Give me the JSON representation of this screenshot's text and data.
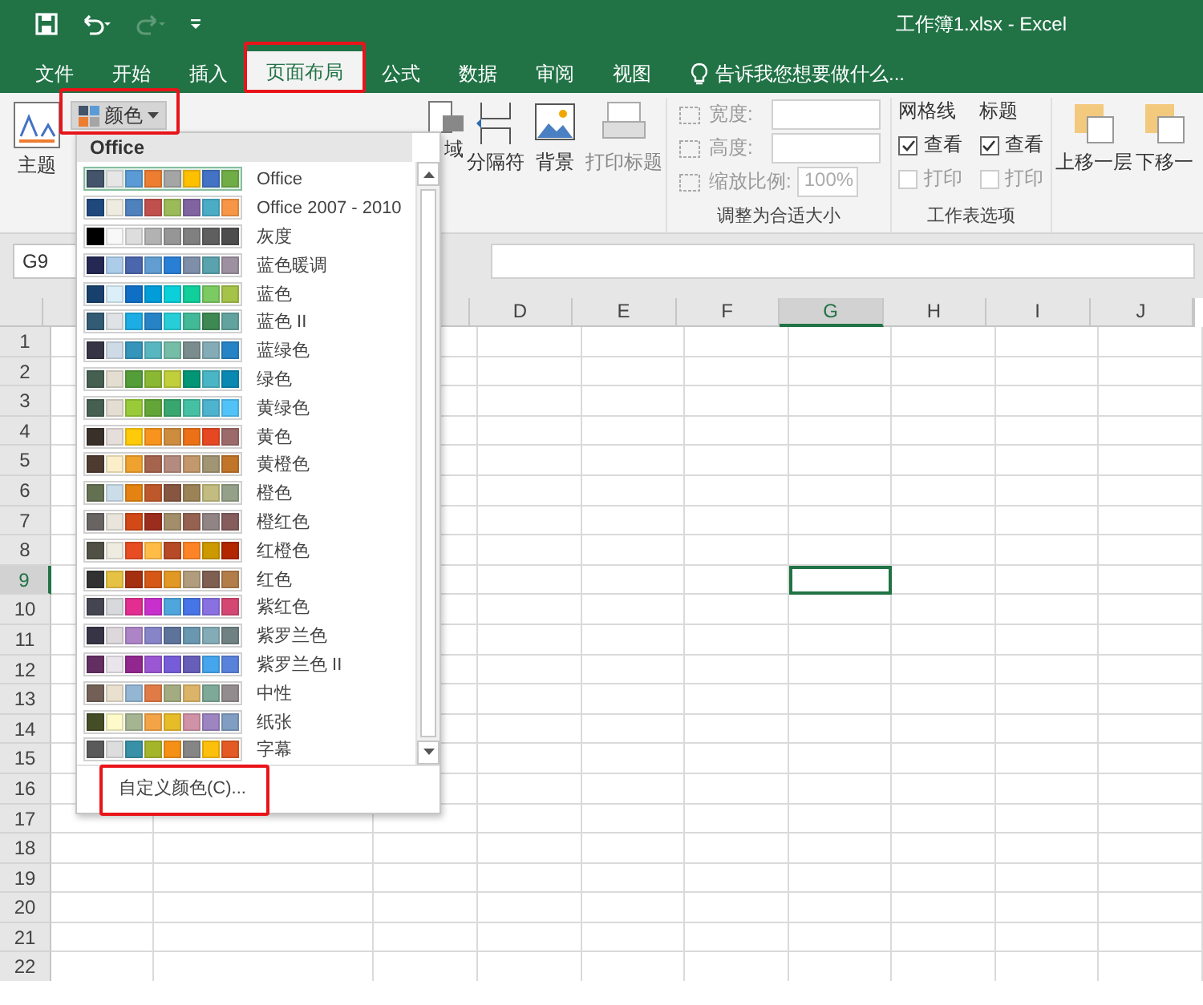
{
  "window": {
    "title": "工作簿1.xlsx - Excel"
  },
  "tabs": [
    {
      "label": "文件",
      "selected": false
    },
    {
      "label": "开始",
      "selected": false
    },
    {
      "label": "插入",
      "selected": false
    },
    {
      "label": "页面布局",
      "selected": true
    },
    {
      "label": "公式",
      "selected": false
    },
    {
      "label": "数据",
      "selected": false
    },
    {
      "label": "审阅",
      "selected": false
    },
    {
      "label": "视图",
      "selected": false
    }
  ],
  "tell_me": {
    "placeholder": "告诉我您想要做什么..."
  },
  "ribbon": {
    "theme_label": "主题",
    "colors_button": "颜色",
    "print_area_fragment": "域",
    "breaks_label": "分隔符",
    "background_label": "背景",
    "print_titles_label": "打印标题",
    "scale": {
      "width_label": "宽度:",
      "height_label": "高度:",
      "scale_label": "缩放比例:",
      "scale_value": "100%",
      "group_label": "调整为合适大小"
    },
    "sheet_options": {
      "groups": [
        {
          "title": "网格线",
          "options": [
            {
              "label": "查看",
              "checked": true
            },
            {
              "label": "打印",
              "checked": false
            }
          ]
        },
        {
          "title": "标题",
          "options": [
            {
              "label": "查看",
              "checked": true
            },
            {
              "label": "打印",
              "checked": false
            }
          ]
        }
      ],
      "group_label": "工作表选项"
    },
    "arrange": {
      "bring_forward": "上移一层",
      "send_backward": "下移一"
    }
  },
  "name_box": "G9",
  "sheet": {
    "columns": [
      {
        "label": "D",
        "selected": false
      },
      {
        "label": "E",
        "selected": false
      },
      {
        "label": "F",
        "selected": false
      },
      {
        "label": "G",
        "selected": true
      },
      {
        "label": "H",
        "selected": false
      },
      {
        "label": "I",
        "selected": false
      },
      {
        "label": "J",
        "selected": false
      }
    ],
    "rows": [
      {
        "label": "1",
        "selected": false
      },
      {
        "label": "2",
        "selected": false
      },
      {
        "label": "3",
        "selected": false
      },
      {
        "label": "4",
        "selected": false
      },
      {
        "label": "5",
        "selected": false
      },
      {
        "label": "6",
        "selected": false
      },
      {
        "label": "7",
        "selected": false
      },
      {
        "label": "8",
        "selected": false
      },
      {
        "label": "9",
        "selected": true
      },
      {
        "label": "10",
        "selected": false
      },
      {
        "label": "11",
        "selected": false
      },
      {
        "label": "12",
        "selected": false
      },
      {
        "label": "13",
        "selected": false
      },
      {
        "label": "14",
        "selected": false
      },
      {
        "label": "15",
        "selected": false
      },
      {
        "label": "16",
        "selected": false
      },
      {
        "label": "17",
        "selected": false
      },
      {
        "label": "18",
        "selected": false
      },
      {
        "label": "19",
        "selected": false
      },
      {
        "label": "20",
        "selected": false
      },
      {
        "label": "21",
        "selected": false
      },
      {
        "label": "22",
        "selected": false
      }
    ]
  },
  "color_menu": {
    "header": "Office",
    "footer": "自定义颜色(C)...",
    "items": [
      {
        "label": "Office",
        "selected": true,
        "swatches": [
          {
            "color": "#44546a"
          },
          {
            "color": "#e7e6e6"
          },
          {
            "color": "#5b9bd5"
          },
          {
            "color": "#ed7d31"
          },
          {
            "color": "#a5a5a5"
          },
          {
            "color": "#ffc000"
          },
          {
            "color": "#4472c4"
          },
          {
            "color": "#70ad47"
          }
        ]
      },
      {
        "label": "Office 2007 - 2010",
        "selected": false,
        "swatches": [
          {
            "color": "#1f497d"
          },
          {
            "color": "#eeece1"
          },
          {
            "color": "#4f81bd"
          },
          {
            "color": "#c0504d"
          },
          {
            "color": "#9bbb59"
          },
          {
            "color": "#8064a2"
          },
          {
            "color": "#4bacc6"
          },
          {
            "color": "#f79646"
          }
        ]
      },
      {
        "label": "灰度",
        "selected": false,
        "swatches": [
          {
            "color": "#000000"
          },
          {
            "color": "#f8f8f8"
          },
          {
            "color": "#dddddd"
          },
          {
            "color": "#b2b2b2"
          },
          {
            "color": "#969696"
          },
          {
            "color": "#808080"
          },
          {
            "color": "#5f5f5f"
          },
          {
            "color": "#4d4d4d"
          }
        ]
      },
      {
        "label": "蓝色暖调",
        "selected": false,
        "swatches": [
          {
            "color": "#242852"
          },
          {
            "color": "#acccea"
          },
          {
            "color": "#4a66ac"
          },
          {
            "color": "#629dd1"
          },
          {
            "color": "#297fd5"
          },
          {
            "color": "#7f8fa9"
          },
          {
            "color": "#5aa2ae"
          },
          {
            "color": "#9d90a0"
          }
        ]
      },
      {
        "label": "蓝色",
        "selected": false,
        "swatches": [
          {
            "color": "#17406d"
          },
          {
            "color": "#dbeff9"
          },
          {
            "color": "#0f6fc6"
          },
          {
            "color": "#009dd9"
          },
          {
            "color": "#0bd0d9"
          },
          {
            "color": "#10cf9b"
          },
          {
            "color": "#7cca62"
          },
          {
            "color": "#a5c249"
          }
        ]
      },
      {
        "label": "蓝色 II",
        "selected": false,
        "swatches": [
          {
            "color": "#335b74"
          },
          {
            "color": "#dfe3e5"
          },
          {
            "color": "#1cade4"
          },
          {
            "color": "#2683c6"
          },
          {
            "color": "#27ced7"
          },
          {
            "color": "#42ba97"
          },
          {
            "color": "#3e8853"
          },
          {
            "color": "#62a39f"
          }
        ]
      },
      {
        "label": "蓝绿色",
        "selected": false,
        "swatches": [
          {
            "color": "#373545"
          },
          {
            "color": "#cedbe6"
          },
          {
            "color": "#3494ba"
          },
          {
            "color": "#58b6c0"
          },
          {
            "color": "#75bda7"
          },
          {
            "color": "#7a8c8e"
          },
          {
            "color": "#84acb6"
          },
          {
            "color": "#2683c6"
          }
        ]
      },
      {
        "label": "绿色",
        "selected": false,
        "swatches": [
          {
            "color": "#455f51"
          },
          {
            "color": "#e3ded1"
          },
          {
            "color": "#549e39"
          },
          {
            "color": "#8ab833"
          },
          {
            "color": "#c0cf3a"
          },
          {
            "color": "#029676"
          },
          {
            "color": "#4ab5c4"
          },
          {
            "color": "#0989b1"
          }
        ]
      },
      {
        "label": "黄绿色",
        "selected": false,
        "swatches": [
          {
            "color": "#455f51"
          },
          {
            "color": "#e3ded1"
          },
          {
            "color": "#99cb38"
          },
          {
            "color": "#63a537"
          },
          {
            "color": "#37a76f"
          },
          {
            "color": "#44c1a3"
          },
          {
            "color": "#4eb3cf"
          },
          {
            "color": "#51c3f9"
          }
        ]
      },
      {
        "label": "黄色",
        "selected": false,
        "swatches": [
          {
            "color": "#39302a"
          },
          {
            "color": "#e5dedb"
          },
          {
            "color": "#ffca08"
          },
          {
            "color": "#f8931d"
          },
          {
            "color": "#ce8d3e"
          },
          {
            "color": "#ec7016"
          },
          {
            "color": "#e64823"
          },
          {
            "color": "#9c6a6a"
          }
        ]
      },
      {
        "label": "黄橙色",
        "selected": false,
        "swatches": [
          {
            "color": "#4e3b30"
          },
          {
            "color": "#fbeec9"
          },
          {
            "color": "#f0a22e"
          },
          {
            "color": "#a5644e"
          },
          {
            "color": "#b58b80"
          },
          {
            "color": "#c3986d"
          },
          {
            "color": "#a19574"
          },
          {
            "color": "#c17529"
          }
        ]
      },
      {
        "label": "橙色",
        "selected": false,
        "swatches": [
          {
            "color": "#637052"
          },
          {
            "color": "#ccddea"
          },
          {
            "color": "#e48312"
          },
          {
            "color": "#bd582c"
          },
          {
            "color": "#865640"
          },
          {
            "color": "#9b8357"
          },
          {
            "color": "#c2bc80"
          },
          {
            "color": "#94a088"
          }
        ]
      },
      {
        "label": "橙红色",
        "selected": false,
        "swatches": [
          {
            "color": "#696464"
          },
          {
            "color": "#e9e5dc"
          },
          {
            "color": "#d34817"
          },
          {
            "color": "#9b2d1f"
          },
          {
            "color": "#a28e6a"
          },
          {
            "color": "#956251"
          },
          {
            "color": "#918485"
          },
          {
            "color": "#855d5d"
          }
        ]
      },
      {
        "label": "红橙色",
        "selected": false,
        "swatches": [
          {
            "color": "#505046"
          },
          {
            "color": "#eeece1"
          },
          {
            "color": "#e84c22"
          },
          {
            "color": "#ffbd47"
          },
          {
            "color": "#b64926"
          },
          {
            "color": "#ff8427"
          },
          {
            "color": "#cc9900"
          },
          {
            "color": "#b22600"
          }
        ]
      },
      {
        "label": "红色",
        "selected": false,
        "swatches": [
          {
            "color": "#323232"
          },
          {
            "color": "#e5c243"
          },
          {
            "color": "#a5300f"
          },
          {
            "color": "#d55816"
          },
          {
            "color": "#e19825"
          },
          {
            "color": "#b19c7d"
          },
          {
            "color": "#7f5f52"
          },
          {
            "color": "#b27d49"
          }
        ]
      },
      {
        "label": "紫红色",
        "selected": false,
        "swatches": [
          {
            "color": "#454551"
          },
          {
            "color": "#d8d9dc"
          },
          {
            "color": "#e32d91"
          },
          {
            "color": "#c830cc"
          },
          {
            "color": "#4ea6dc"
          },
          {
            "color": "#4775e7"
          },
          {
            "color": "#8971e1"
          },
          {
            "color": "#d54773"
          }
        ]
      },
      {
        "label": "紫罗兰色",
        "selected": false,
        "swatches": [
          {
            "color": "#373545"
          },
          {
            "color": "#dcd8dc"
          },
          {
            "color": "#ad84c6"
          },
          {
            "color": "#8784c7"
          },
          {
            "color": "#5d739a"
          },
          {
            "color": "#6997af"
          },
          {
            "color": "#84acb6"
          },
          {
            "color": "#6f8183"
          }
        ]
      },
      {
        "label": "紫罗兰色 II",
        "selected": false,
        "swatches": [
          {
            "color": "#632e62"
          },
          {
            "color": "#eae5eb"
          },
          {
            "color": "#92278f"
          },
          {
            "color": "#9b57d3"
          },
          {
            "color": "#755dd9"
          },
          {
            "color": "#665eb8"
          },
          {
            "color": "#45a5ed"
          },
          {
            "color": "#5982db"
          }
        ]
      },
      {
        "label": "中性",
        "selected": false,
        "swatches": [
          {
            "color": "#726056"
          },
          {
            "color": "#eae0cf"
          },
          {
            "color": "#93b6d2"
          },
          {
            "color": "#e07b48"
          },
          {
            "color": "#a4ab80"
          },
          {
            "color": "#dcb469"
          },
          {
            "color": "#7ea898"
          },
          {
            "color": "#938c8e"
          }
        ]
      },
      {
        "label": "纸张",
        "selected": false,
        "swatches": [
          {
            "color": "#444d26"
          },
          {
            "color": "#fefac9"
          },
          {
            "color": "#a5b592"
          },
          {
            "color": "#f3a447"
          },
          {
            "color": "#e7bc29"
          },
          {
            "color": "#d092a7"
          },
          {
            "color": "#9c85c0"
          },
          {
            "color": "#809ec2"
          }
        ]
      },
      {
        "label": "字幕",
        "selected": false,
        "swatches": [
          {
            "color": "#5a5a5a"
          },
          {
            "color": "#dddddd"
          },
          {
            "color": "#3891a7"
          },
          {
            "color": "#a5b52a"
          },
          {
            "color": "#f59016"
          },
          {
            "color": "#858585"
          },
          {
            "color": "#fcbf0c"
          },
          {
            "color": "#e35a24"
          }
        ]
      }
    ]
  },
  "highlights": [
    {
      "kind": "tab"
    },
    {
      "kind": "colors_button"
    },
    {
      "kind": "custom_colors"
    }
  ]
}
